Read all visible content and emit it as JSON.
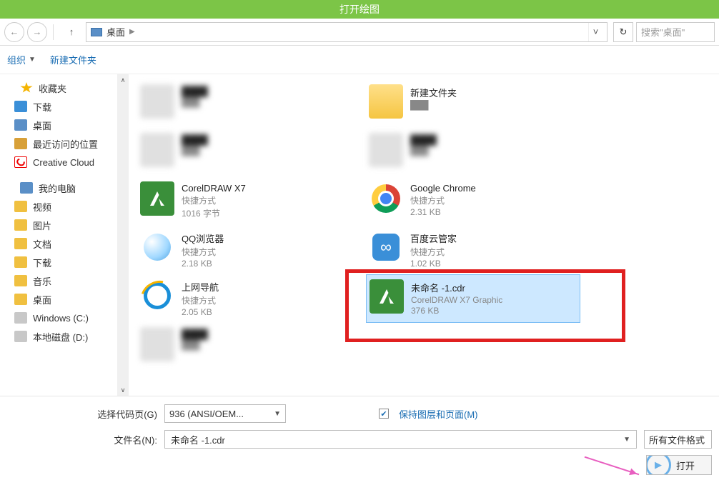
{
  "title": "打开绘图",
  "breadcrumb": {
    "location": "桌面"
  },
  "search": {
    "placeholder": "搜索\"桌面\""
  },
  "toolbar": {
    "organize": "组织",
    "new_folder": "新建文件夹"
  },
  "sidebar": {
    "favorites": {
      "label": "收藏夹",
      "items": [
        "下载",
        "桌面",
        "最近访问的位置",
        "Creative Cloud"
      ]
    },
    "my_pc": {
      "label": "我的电脑",
      "items": [
        "视频",
        "图片",
        "文档",
        "下载",
        "音乐",
        "桌面",
        "Windows (C:)",
        "本地磁盘 (D:)"
      ]
    }
  },
  "files": {
    "col1": [
      {
        "name": "",
        "meta1": "",
        "meta2": "",
        "blur": true
      },
      {
        "name": "",
        "meta1": "",
        "meta2": "",
        "blur": true
      },
      {
        "name": "CorelDRAW X7",
        "meta1": "快捷方式",
        "meta2": "1016 字节",
        "icon": "cdraw"
      },
      {
        "name": "QQ浏览器",
        "meta1": "快捷方式",
        "meta2": "2.18 KB",
        "icon": "qq"
      },
      {
        "name": "上网导航",
        "meta1": "快捷方式",
        "meta2": "2.05 KB",
        "icon": "ie"
      },
      {
        "name": "",
        "meta1": "",
        "meta2": "",
        "blur": true
      }
    ],
    "col2": [
      {
        "name": "新建文件夹",
        "meta1": "",
        "meta2": "",
        "icon": "folder"
      },
      {
        "name": "",
        "meta1": "",
        "meta2": "",
        "blur": true
      },
      {
        "name": "Google Chrome",
        "meta1": "快捷方式",
        "meta2": "2.31 KB",
        "icon": "chrome"
      },
      {
        "name": "百度云管家",
        "meta1": "快捷方式",
        "meta2": "1.02 KB",
        "icon": "baidu"
      },
      {
        "name": "未命名 -1.cdr",
        "meta1": "CorelDRAW X7 Graphic",
        "meta2": "376 KB",
        "icon": "cdraw",
        "selected": true
      }
    ]
  },
  "bottom": {
    "codepage_label": "选择代码页(G)",
    "codepage_value": "936   (ANSI/OEM...",
    "keep_layers": "保持图层和页面(M)",
    "filename_label": "文件名(N):",
    "filename_value": "未命名 -1.cdr",
    "filetype": "所有文件格式",
    "open_btn": "打开"
  }
}
